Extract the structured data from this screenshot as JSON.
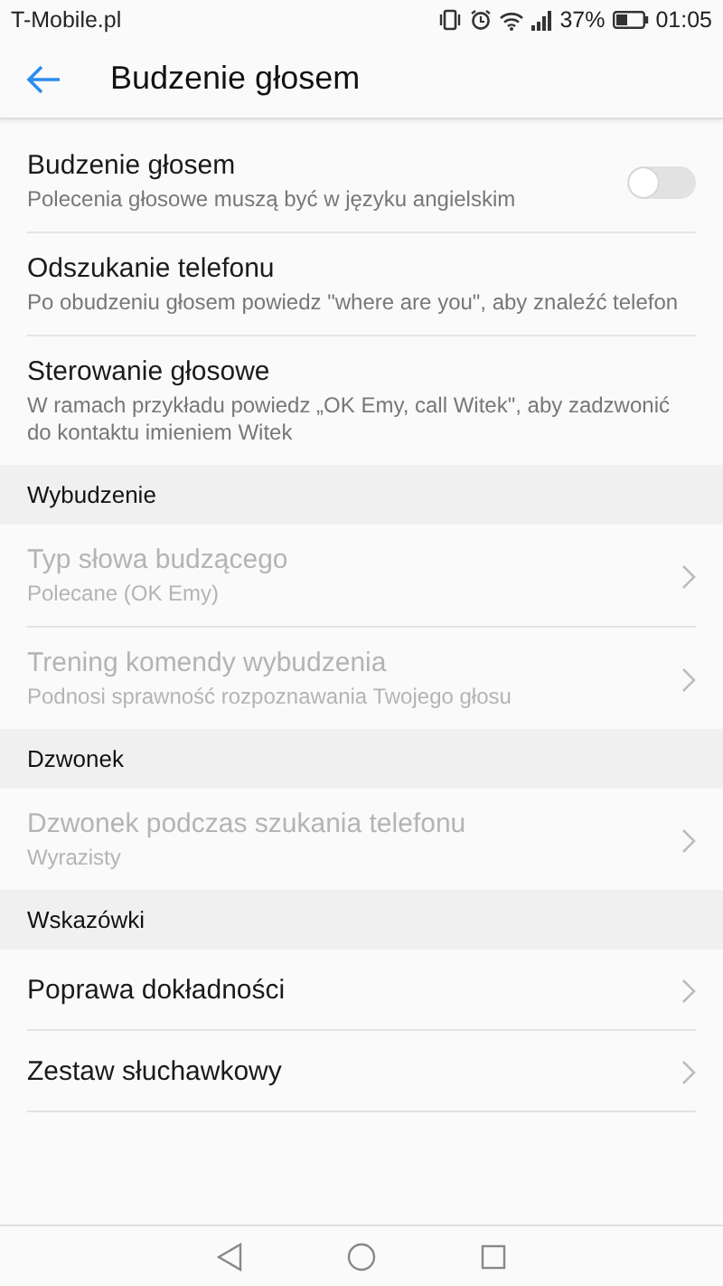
{
  "status_bar": {
    "carrier": "T-Mobile.pl",
    "battery": "37%",
    "time": "01:05"
  },
  "header": {
    "title": "Budzenie głosem"
  },
  "sections": [
    {
      "items": [
        {
          "kind": "toggle",
          "title": "Budzenie głosem",
          "subtitle": "Polecenia głosowe muszą być w języku angielskim",
          "on": false,
          "disabled": false
        },
        {
          "kind": "plain",
          "title": "Odszukanie telefonu",
          "subtitle": "Po obudzeniu głosem powiedz \"where are you\", aby znaleźć telefon",
          "disabled": false
        },
        {
          "kind": "plain",
          "title": "Sterowanie głosowe",
          "subtitle": "W ramach przykładu powiedz „OK Emy, call Witek\", aby zadzwonić do kontaktu imieniem Witek",
          "disabled": false
        }
      ]
    },
    {
      "heading": "Wybudzenie",
      "items": [
        {
          "kind": "link",
          "title": "Typ słowa budzącego",
          "subtitle": "Polecane (OK Emy)",
          "disabled": true
        },
        {
          "kind": "link",
          "title": "Trening komendy wybudzenia",
          "subtitle": "Podnosi sprawność rozpoznawania Twojego głosu",
          "disabled": true
        }
      ]
    },
    {
      "heading": "Dzwonek",
      "items": [
        {
          "kind": "link",
          "title": "Dzwonek podczas szukania telefonu",
          "subtitle": "Wyrazisty",
          "disabled": true
        }
      ]
    },
    {
      "heading": "Wskazówki",
      "items": [
        {
          "kind": "link",
          "title": "Poprawa dokładności",
          "disabled": false
        },
        {
          "kind": "link",
          "title": "Zestaw słuchawkowy",
          "disabled": false
        }
      ]
    }
  ]
}
